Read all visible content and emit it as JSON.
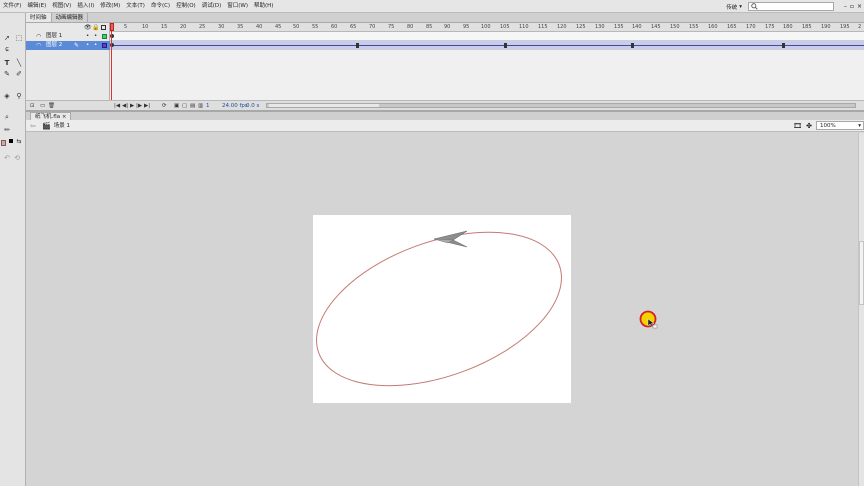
{
  "menu": {
    "items": [
      "文件(F)",
      "编辑(E)",
      "视图(V)",
      "插入(I)",
      "修改(M)",
      "文本(T)",
      "命令(C)",
      "控制(O)",
      "调试(D)",
      "窗口(W)",
      "帮助(H)"
    ],
    "workspace": "传统",
    "search_placeholder": ""
  },
  "timeline": {
    "tabs": [
      {
        "label": "时间轴",
        "active": true
      },
      {
        "label": "动画编辑器",
        "active": false
      }
    ],
    "layers": [
      {
        "name": "图层 1",
        "selected": false
      },
      {
        "name": "图层 2",
        "selected": true
      }
    ],
    "ruler_ticks": [
      "1",
      "5",
      "10",
      "15",
      "20",
      "25",
      "30",
      "35",
      "40",
      "45",
      "50",
      "55",
      "60",
      "65",
      "70",
      "75",
      "80",
      "85",
      "90",
      "95",
      "100",
      "105",
      "110",
      "115",
      "120",
      "125",
      "130",
      "135",
      "140",
      "145",
      "150",
      "155",
      "160",
      "165",
      "170",
      "175",
      "180",
      "185",
      "190",
      "195",
      "2"
    ],
    "current_frame": "1",
    "fps": "24.00 fps",
    "elapsed": "0.0 s"
  },
  "document": {
    "tab_label": "纸飞机.fla",
    "scene_label": "场景 1",
    "zoom": "100%"
  },
  "colors": {
    "path_stroke": "#c47a72",
    "plane_fill": "#8e8e8e",
    "cursor_ring": "#d4202a",
    "cursor_fill": "#f2d200",
    "stroke_swatch": "#c0392b",
    "fill_swatch": "#f09aa0",
    "selected_layer": "#5b8bd6",
    "playhead": "#e03030"
  }
}
